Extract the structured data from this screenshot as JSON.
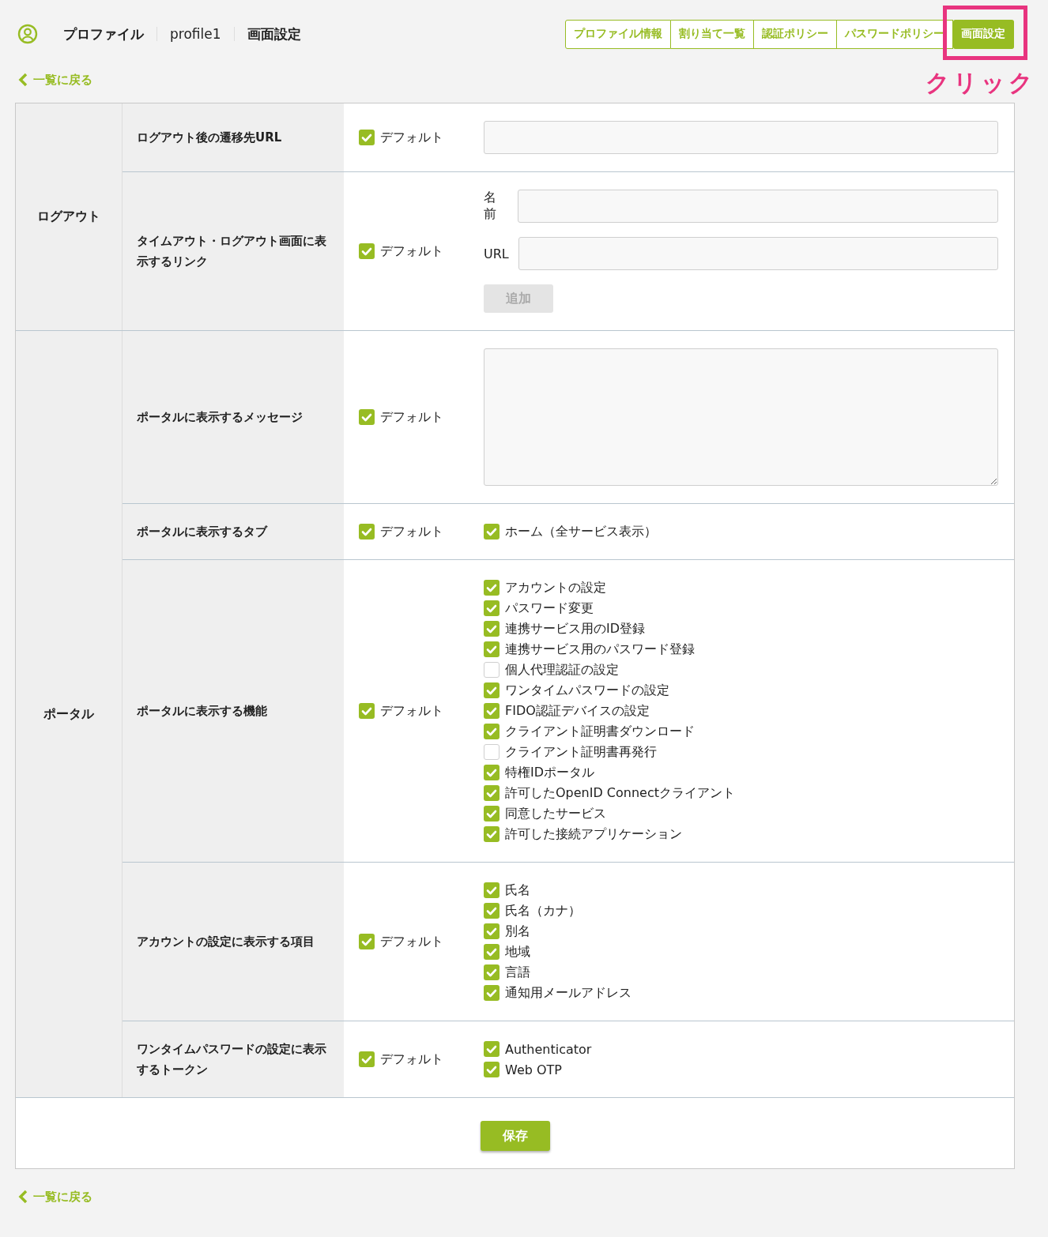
{
  "breadcrumb": [
    "プロファイル",
    "profile1",
    "画面設定"
  ],
  "tabs": [
    {
      "label": "プロファイル情報",
      "selected": false,
      "highlighted": false
    },
    {
      "label": "割り当て一覧",
      "selected": false,
      "highlighted": false
    },
    {
      "label": "認証ポリシー",
      "selected": false,
      "highlighted": false
    },
    {
      "label": "パスワードポリシー",
      "selected": false,
      "highlighted": false
    },
    {
      "label": "画面設定",
      "selected": true,
      "highlighted": true
    }
  ],
  "annotation": "クリック",
  "back_link_top": "一覧に戻る",
  "sections": [
    {
      "group": "ログアウト",
      "rows": [
        {
          "label": "ログアウト後の遷移先URL",
          "default": {
            "label": "デフォルト",
            "checked": true
          },
          "kind": "input"
        },
        {
          "label": "タイムアウト・ログアウト画面に表示するリンク",
          "default": {
            "label": "デフォルト",
            "checked": true
          },
          "kind": "link_form",
          "fields": [
            {
              "label": "名前"
            },
            {
              "label": "URL"
            }
          ],
          "button": {
            "label": "追加",
            "disabled": true
          }
        }
      ]
    },
    {
      "group": "ポータル",
      "rows": [
        {
          "label": "ポータルに表示するメッセージ",
          "default": {
            "label": "デフォルト",
            "checked": true
          },
          "kind": "textarea"
        },
        {
          "label": "ポータルに表示するタブ",
          "default": {
            "label": "デフォルト",
            "checked": true
          },
          "kind": "checklist",
          "options": [
            {
              "label": "ホーム（全サービス表示）",
              "checked": true
            }
          ]
        },
        {
          "label": "ポータルに表示する機能",
          "default": {
            "label": "デフォルト",
            "checked": true
          },
          "kind": "checklist",
          "options": [
            {
              "label": "アカウントの設定",
              "checked": true
            },
            {
              "label": "パスワード変更",
              "checked": true
            },
            {
              "label": "連携サービス用のID登録",
              "checked": true
            },
            {
              "label": "連携サービス用のパスワード登録",
              "checked": true
            },
            {
              "label": "個人代理認証の設定",
              "checked": false
            },
            {
              "label": "ワンタイムパスワードの設定",
              "checked": true
            },
            {
              "label": "FIDO認証デバイスの設定",
              "checked": true
            },
            {
              "label": "クライアント証明書ダウンロード",
              "checked": true
            },
            {
              "label": "クライアント証明書再発行",
              "checked": false
            },
            {
              "label": "特権IDポータル",
              "checked": true
            },
            {
              "label": "許可したOpenID Connectクライアント",
              "checked": true
            },
            {
              "label": "同意したサービス",
              "checked": true
            },
            {
              "label": "許可した接続アプリケーション",
              "checked": true
            }
          ]
        },
        {
          "label": "アカウントの設定に表示する項目",
          "default": {
            "label": "デフォルト",
            "checked": true
          },
          "kind": "checklist",
          "options": [
            {
              "label": "氏名",
              "checked": true
            },
            {
              "label": "氏名（カナ）",
              "checked": true
            },
            {
              "label": "別名",
              "checked": true
            },
            {
              "label": "地域",
              "checked": true
            },
            {
              "label": "言語",
              "checked": true
            },
            {
              "label": "通知用メールアドレス",
              "checked": true
            }
          ]
        },
        {
          "label": "ワンタイムパスワードの設定に表示するトークン",
          "default": {
            "label": "デフォルト",
            "checked": true
          },
          "kind": "checklist",
          "options": [
            {
              "label": "Authenticator",
              "checked": true
            },
            {
              "label": "Web OTP",
              "checked": true
            }
          ]
        }
      ]
    }
  ],
  "save_button": "保存",
  "back_link_bottom": "一覧に戻る"
}
